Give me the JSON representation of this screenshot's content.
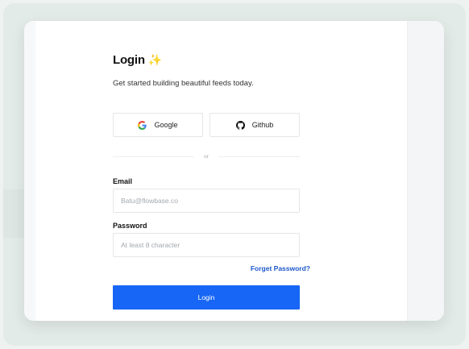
{
  "login": {
    "title": "Login",
    "title_icon": "sparkle-icon",
    "subtitle": "Get started building beautiful feeds today.",
    "oauth": {
      "google_label": "Google",
      "github_label": "Github"
    },
    "divider_text": "or",
    "email": {
      "label": "Email",
      "placeholder": "Batu@flowbase.co",
      "value": ""
    },
    "password": {
      "label": "Password",
      "placeholder": "At least 8 character",
      "value": ""
    },
    "forgot_password": "Forget Password?",
    "submit_label": "Login"
  },
  "colors": {
    "primary": "#1766f5",
    "link": "#1d59c9",
    "sparkle": "#e7b84b"
  }
}
